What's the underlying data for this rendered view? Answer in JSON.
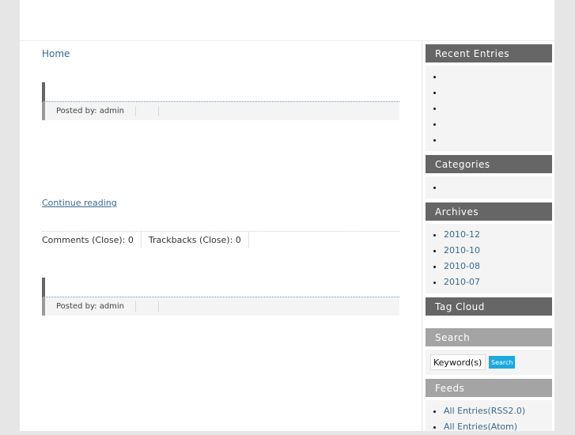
{
  "breadcrumb": {
    "home": "Home"
  },
  "entries": [
    {
      "title": "",
      "posted_by": "Posted by: admin"
    },
    {
      "title": "",
      "posted_by": "Posted by: admin"
    }
  ],
  "continue_reading": "Continue reading",
  "comments_bar": {
    "comments": "Comments (Close): 0",
    "trackbacks": "Trackbacks (Close): 0"
  },
  "sidebar": {
    "recent_entries": {
      "title": "Recent Entries",
      "items": [
        "",
        "",
        "",
        "",
        ""
      ]
    },
    "categories": {
      "title": "Categories",
      "items": [
        ""
      ]
    },
    "archives": {
      "title": "Archives",
      "items": [
        "2010-12",
        "2010-10",
        "2010-08",
        "2010-07"
      ]
    },
    "tag_cloud": {
      "title": "Tag Cloud"
    },
    "search": {
      "title": "Search",
      "input_value": "Keyword(s)",
      "button_label": "Search"
    },
    "feeds": {
      "title": "Feeds",
      "items": [
        "All Entries(RSS2.0)",
        "All Entries(Atom)"
      ]
    }
  },
  "colors": {
    "widget_header": "#666666",
    "widget_header_light": "#a4a4a4",
    "link": "#3a6a8c",
    "search_button": "#1ca8e0"
  }
}
